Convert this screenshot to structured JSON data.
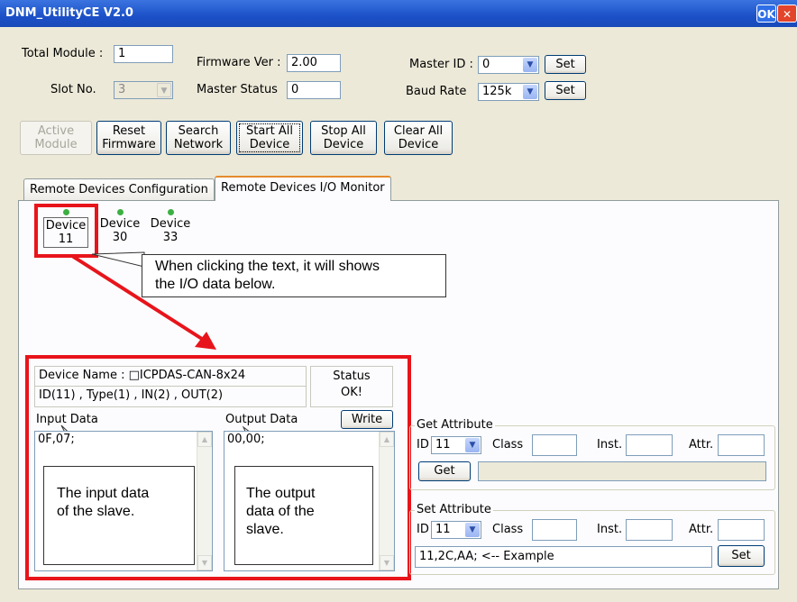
{
  "window": {
    "title": "DNM_UtilityCE V2.0",
    "ok_label": "OK",
    "close_label": "✕"
  },
  "top": {
    "total_module_label": "Total Module :",
    "total_module_value": "1",
    "slot_no_label": "Slot No.",
    "slot_no_value": "3",
    "firmware_ver_label": "Firmware Ver :",
    "firmware_ver_value": "2.00",
    "master_status_label": "Master Status",
    "master_status_value": "0",
    "master_id_label": "Master ID :",
    "master_id_value": "0",
    "baud_rate_label": "Baud Rate",
    "baud_rate_value": "125k",
    "set_label": "Set"
  },
  "toolbar": {
    "active_module": [
      "Active",
      "Module"
    ],
    "reset_firmware": [
      "Reset",
      "Firmware"
    ],
    "search_network": [
      "Search",
      "Network"
    ],
    "start_all_device": [
      "Start All",
      "Device"
    ],
    "stop_all_device": [
      "Stop All",
      "Device"
    ],
    "clear_all_device": [
      "Clear All",
      "Device"
    ]
  },
  "tabs": [
    "Remote Devices Configuration",
    "Remote Devices I/O Monitor"
  ],
  "devices": [
    {
      "label": "Device",
      "id": "11"
    },
    {
      "label": "Device",
      "id": "30"
    },
    {
      "label": "Device",
      "id": "33"
    }
  ],
  "callouts": {
    "click": [
      "When clicking the text, it will shows",
      "the I/O data below."
    ],
    "input": [
      "The input data",
      "of the slave."
    ],
    "output": [
      "The output",
      "data of the",
      "slave."
    ]
  },
  "device_info": {
    "name": "Device Name : □ICPDAS-CAN-8x24",
    "detail": "ID(11) , Type(1) , IN(2) , OUT(2)",
    "status_label": "Status",
    "status_value": "OK!"
  },
  "io": {
    "input_label": "Input Data",
    "input_value": "0F,07;",
    "output_label": "Output Data",
    "output_value": "00,00;",
    "write_label": "Write"
  },
  "get_attr": {
    "title": "Get Attribute",
    "id_label": "ID",
    "id_value": "11",
    "class_label": "Class",
    "inst_label": "Inst.",
    "attr_label": "Attr.",
    "button": "Get"
  },
  "set_attr": {
    "title": "Set Attribute",
    "id_label": "ID",
    "id_value": "11",
    "class_label": "Class",
    "inst_label": "Inst.",
    "attr_label": "Attr.",
    "example": "11,2C,AA;    <-- Example",
    "button": "Set"
  },
  "colors": {
    "highlight": "#e8141b",
    "titlebar": "#1b50c8",
    "led": "#3cb043"
  }
}
